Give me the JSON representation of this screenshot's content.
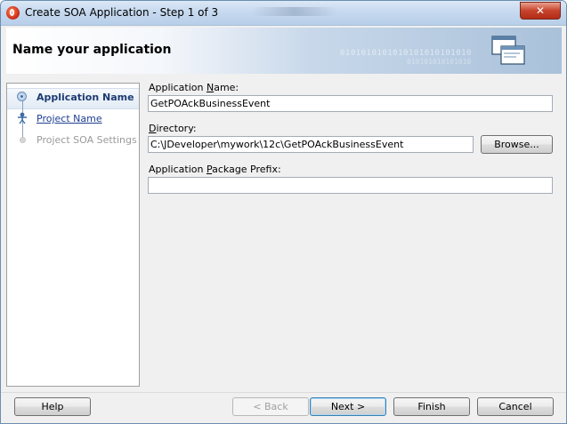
{
  "window": {
    "title": "Create SOA Application - Step 1 of 3",
    "close_symbol": "✕",
    "icon": "oracle-jdeveloper-icon"
  },
  "header": {
    "title": "Name your application",
    "decor_binary_1": "0101010101010101010101010",
    "decor_binary_2": "010101010101010",
    "icon": "application-windows-icon"
  },
  "steps": [
    {
      "label": "Application Name",
      "state": "current"
    },
    {
      "label": "Project Name",
      "state": "link"
    },
    {
      "label": "Project SOA Settings",
      "state": "disabled"
    }
  ],
  "form": {
    "app_name": {
      "label_prefix": "Application ",
      "label_mnemonic": "N",
      "label_suffix": "ame:",
      "value": "GetPOAckBusinessEvent"
    },
    "directory": {
      "label_prefix": "",
      "label_mnemonic": "D",
      "label_suffix": "irectory:",
      "value": "C:\\JDeveloper\\mywork\\12c\\GetPOAckBusinessEvent"
    },
    "package_prefix": {
      "label_prefix": "Application ",
      "label_mnemonic": "P",
      "label_suffix": "ackage Prefix:",
      "value": ""
    },
    "browse_label": "Browse..."
  },
  "buttons": {
    "help": "Help",
    "back": "< Back",
    "next": "Next >",
    "finish": "Finish",
    "cancel": "Cancel"
  }
}
